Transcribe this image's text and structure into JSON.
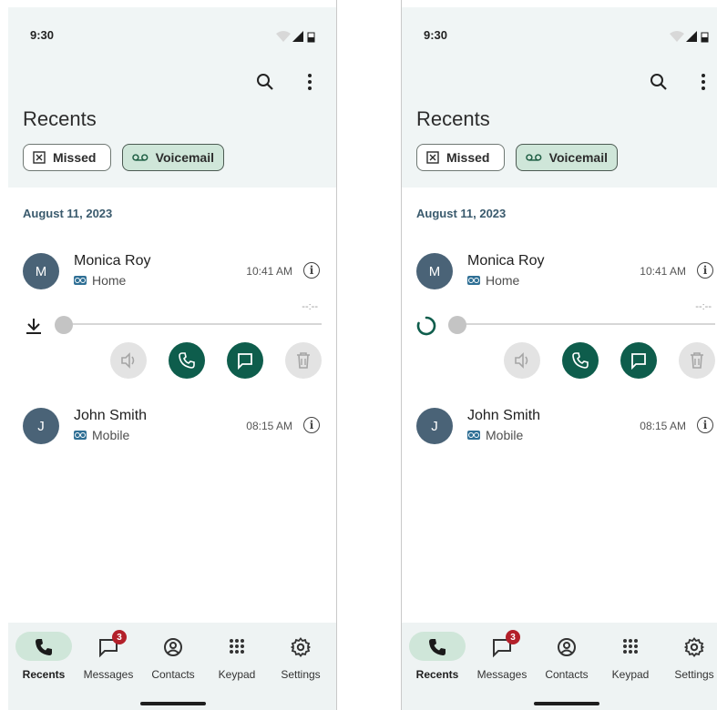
{
  "screens": [
    {
      "status": {
        "time": "9:30"
      },
      "title": "Recents",
      "chips": [
        {
          "label": "Missed",
          "icon": "missed-x-icon"
        },
        {
          "label": "Voicemail",
          "icon": "voicemail-icon",
          "selected": true
        }
      ],
      "date": "August 11, 2023",
      "calls": [
        {
          "initial": "M",
          "name": "Monica Roy",
          "type": "Home",
          "time": "10:41 AM",
          "expanded": true
        },
        {
          "initial": "J",
          "name": "John Smith",
          "type": "Mobile",
          "time": "08:15 AM"
        }
      ],
      "player": {
        "duration": "--:--",
        "progress": 0,
        "state": "download"
      },
      "nav": [
        {
          "label": "Recents",
          "icon": "phone-icon",
          "active": true
        },
        {
          "label": "Messages",
          "icon": "message-icon",
          "badge": "3"
        },
        {
          "label": "Contacts",
          "icon": "contacts-icon"
        },
        {
          "label": "Keypad",
          "icon": "keypad-icon"
        },
        {
          "label": "Settings",
          "icon": "settings-icon"
        }
      ]
    },
    {
      "status": {
        "time": "9:30"
      },
      "title": "Recents",
      "chips": [
        {
          "label": "Missed",
          "icon": "missed-x-icon"
        },
        {
          "label": "Voicemail",
          "icon": "voicemail-icon",
          "selected": true
        }
      ],
      "date": "August 11, 2023",
      "calls": [
        {
          "initial": "M",
          "name": "Monica Roy",
          "type": "Home",
          "time": "10:41 AM",
          "expanded": true
        },
        {
          "initial": "J",
          "name": "John Smith",
          "type": "Mobile",
          "time": "08:15 AM"
        }
      ],
      "player": {
        "duration": "--:--",
        "progress": 0,
        "state": "loading"
      },
      "nav": [
        {
          "label": "Recents",
          "icon": "phone-icon",
          "active": true
        },
        {
          "label": "Messages",
          "icon": "message-icon",
          "badge": "3"
        },
        {
          "label": "Contacts",
          "icon": "contacts-icon"
        },
        {
          "label": "Keypad",
          "icon": "keypad-icon"
        },
        {
          "label": "Settings",
          "icon": "settings-icon"
        }
      ]
    }
  ],
  "colors": {
    "accent": "#0e5d4c",
    "chip_selected": "#cfe6d9",
    "avatar": "#4a6377",
    "badge": "#b3202a"
  }
}
